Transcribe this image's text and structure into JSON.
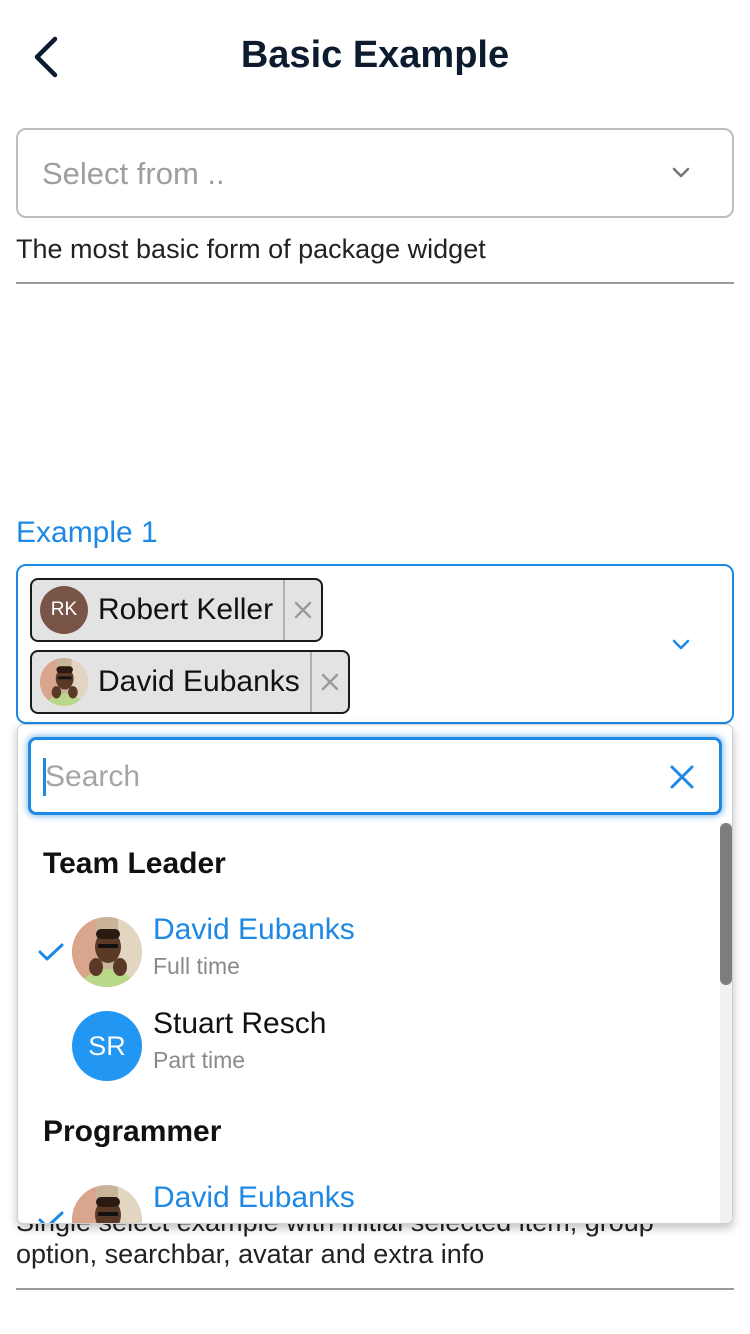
{
  "appbar": {
    "title": "Basic Example",
    "back_icon": "arrow-back-icon"
  },
  "basic": {
    "placeholder": "Select from ..",
    "description": "The most basic form of package widget",
    "chevron_icon": "chevron-down-icon"
  },
  "example1": {
    "label": "Example 1",
    "chips": [
      {
        "initials": "RK",
        "name": "Robert Keller",
        "avatar_color": "#795548"
      },
      {
        "name": "David Eubanks",
        "avatar": "photo"
      }
    ],
    "description": "Single select example with initial selected item, group option, searchbar, avatar and extra info"
  },
  "dropdown": {
    "search_placeholder": "Search",
    "clear_icon": "close-icon",
    "groups": [
      {
        "header": "Team Leader",
        "options": [
          {
            "name": "David Eubanks",
            "subtitle": "Full time",
            "selected": true,
            "avatar": "photo"
          },
          {
            "name": "Stuart Resch",
            "initials": "SR",
            "subtitle": "Part time",
            "selected": false,
            "avatar_color": "#2196f3"
          }
        ]
      },
      {
        "header": "Programmer",
        "options": [
          {
            "name": "David Eubanks",
            "selected": true,
            "avatar": "photo"
          }
        ]
      }
    ]
  },
  "colors": {
    "accent": "#1e88e5",
    "chip_bg": "#e3e3e3",
    "title": "#0d1b2e"
  }
}
